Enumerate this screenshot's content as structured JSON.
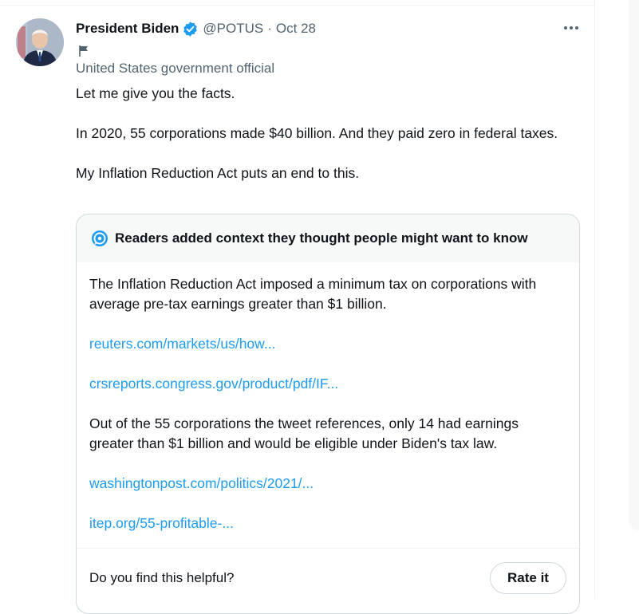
{
  "tweet": {
    "author_name": "President Biden",
    "handle": "@POTUS",
    "separator": "·",
    "date": "Oct 28",
    "affiliation": "United States government official",
    "more_label": "•••",
    "lines": {
      "l1": "Let me give you the facts.",
      "l2": "In 2020, 55 corporations made $40 billion. And they paid zero in federal taxes.",
      "l3": "My Inflation Reduction Act puts an end to this."
    }
  },
  "community_note": {
    "title": "Readers added context they thought people might want to know",
    "paragraph1": "The Inflation Reduction Act imposed a minimum tax on corporations with average pre-tax earnings greater than $1 billion.",
    "link1": "reuters.com/markets/us/how...",
    "link2": "crsreports.congress.gov/product/pdf/IF...",
    "paragraph2": "Out of the 55 corporations the tweet references, only 14 had earnings greater than $1 billion and would be eligible under Biden's tax law.",
    "link3": "washingtonpost.com/politics/2021/...",
    "link4": "itep.org/55-profitable-...",
    "helpful_prompt": "Do you find this helpful?",
    "rate_label": "Rate it"
  },
  "colors": {
    "accent": "#1d9bf0",
    "text_primary": "#0f1419",
    "text_secondary": "#536471",
    "border": "#cfd9de"
  },
  "icons": {
    "verified": "verified-badge-icon",
    "more": "more-icon",
    "flag": "flag-icon",
    "note": "community-notes-icon"
  }
}
